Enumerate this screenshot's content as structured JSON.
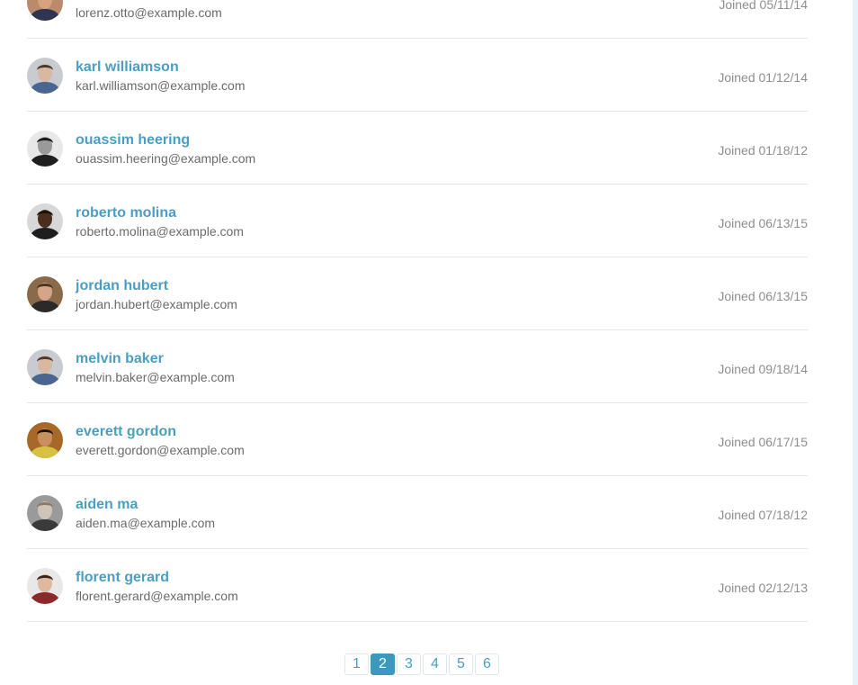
{
  "users": [
    {
      "name": "",
      "email": "lorenz.otto@example.com",
      "joined": "Joined 05/11/14",
      "avatar": {
        "skin": "#d8a27e",
        "hair": "#6b4a2c",
        "shirt": "#2d3550",
        "bg": "#b98b6a"
      }
    },
    {
      "name": "karl williamson",
      "email": "karl.williamson@example.com",
      "joined": "Joined 01/12/14",
      "avatar": {
        "skin": "#d9b8a2",
        "hair": "#4a3a2e",
        "shirt": "#4a6590",
        "bg": "#c8cbd0"
      }
    },
    {
      "name": "ouassim heering",
      "email": "ouassim.heering@example.com",
      "joined": "Joined 01/18/12",
      "avatar": {
        "skin": "#9a9a9a",
        "hair": "#1a1a1a",
        "shirt": "#1e1e1e",
        "bg": "#e8e8e8"
      }
    },
    {
      "name": "roberto molina",
      "email": "roberto.molina@example.com",
      "joined": "Joined 06/13/15",
      "avatar": {
        "skin": "#4a2e1e",
        "hair": "#1a1410",
        "shirt": "#1e1e1e",
        "bg": "#d8d8d8"
      }
    },
    {
      "name": "jordan hubert",
      "email": "jordan.hubert@example.com",
      "joined": "Joined 06/13/15",
      "avatar": {
        "skin": "#d4a58a",
        "hair": "#4a3420",
        "shirt": "#2a2a2a",
        "bg": "#8a6a4a"
      }
    },
    {
      "name": "melvin baker",
      "email": "melvin.baker@example.com",
      "joined": "Joined 09/18/14",
      "avatar": {
        "skin": "#d9b8a2",
        "hair": "#4a3a2e",
        "shirt": "#4a6590",
        "bg": "#c8cbd0"
      }
    },
    {
      "name": "everett gordon",
      "email": "everett.gordon@example.com",
      "joined": "Joined 06/17/15",
      "avatar": {
        "skin": "#c89060",
        "hair": "#1a1410",
        "shirt": "#d8c040",
        "bg": "#a86828"
      }
    },
    {
      "name": "aiden ma",
      "email": "aiden.ma@example.com",
      "joined": "Joined 07/18/12",
      "avatar": {
        "skin": "#cfc4b8",
        "hair": "#8a7a6a",
        "shirt": "#3a3a3a",
        "bg": "#9a9a9a"
      }
    },
    {
      "name": "florent gerard",
      "email": "florent.gerard@example.com",
      "joined": "Joined 02/12/13",
      "avatar": {
        "skin": "#e0b8a0",
        "hair": "#3a2418",
        "shirt": "#8a2a2a",
        "bg": "#e8e8e8"
      }
    }
  ],
  "pagination": {
    "pages": [
      "1",
      "2",
      "3",
      "4",
      "5",
      "6"
    ],
    "current": "2"
  }
}
